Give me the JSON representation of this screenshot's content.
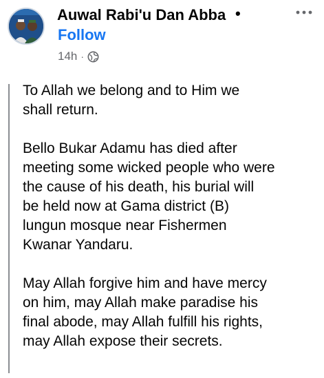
{
  "post": {
    "author_name": "Auwal Rabi'u Dan Abba",
    "name_separator": "•",
    "follow_label": "Follow",
    "timestamp": "14h",
    "meta_separator": "·",
    "privacy_icon": "globe-icon",
    "more_icon": "more-dots-icon",
    "paragraphs": [
      "To Allah we belong and to Him we\nshall return.",
      "Bello Bukar Adamu has died after\nmeeting some wicked people who were\nthe cause of his death, his burial will\nbe held now at Gama district (B)\nlungun mosque near Fishermen\nKwanar Yandaru.",
      "May Allah forgive him and have mercy\non him, may Allah make paradise his\nfinal abode, may Allah fulfill his rights,\nmay Allah expose their secrets."
    ]
  },
  "colors": {
    "follow": "#1877f2",
    "meta_gray": "#65676b",
    "quote_bar": "#8a8d91",
    "text": "#050505"
  }
}
